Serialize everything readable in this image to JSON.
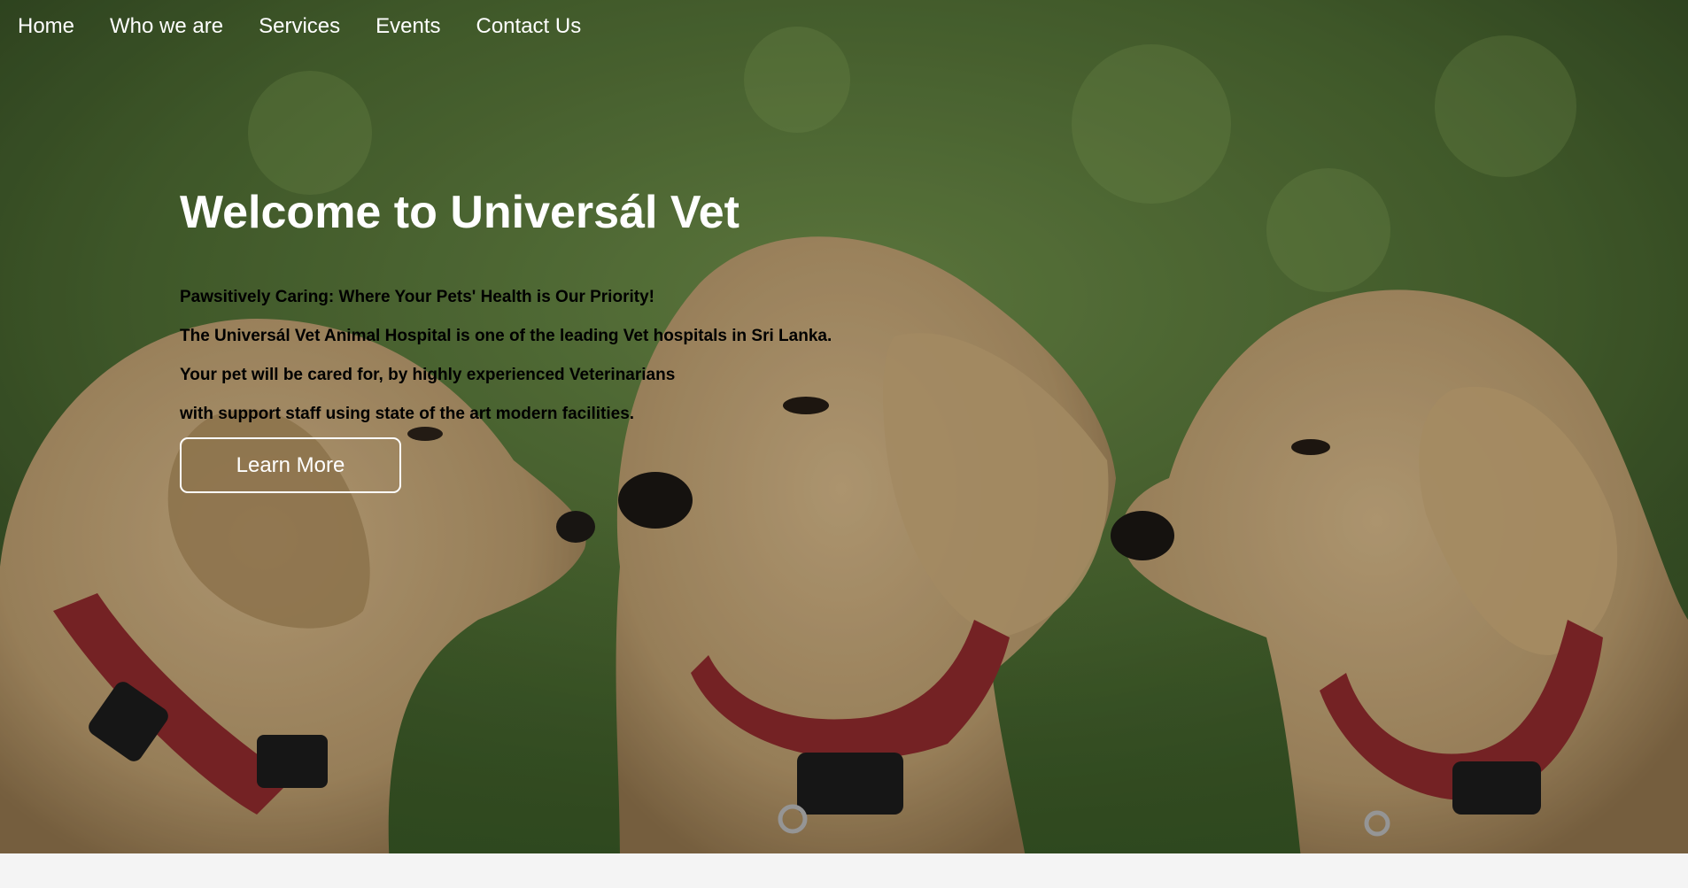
{
  "nav": {
    "items": [
      {
        "label": "Home"
      },
      {
        "label": "Who we are"
      },
      {
        "label": "Services"
      },
      {
        "label": "Events"
      },
      {
        "label": "Contact Us"
      }
    ]
  },
  "hero": {
    "title": "Welcome to Universál Vet",
    "lines": [
      "Pawsitively Caring: Where Your Pets' Health is Our Priority!",
      "The Universál Vet Animal Hospital is one of the leading Vet hospitals in Sri Lanka.",
      "Your pet will be cared for, by highly experienced Veterinarians",
      "with support staff using state of the art modern facilities."
    ],
    "button_label": "Learn More",
    "image": "three-golden-retriever-puppies-red-collars-on-grass"
  },
  "colors": {
    "grass_dark": "#3f5a2c",
    "grass_light": "#6f8f4a",
    "puppy_fur": "#b89a6c",
    "collar_red": "#8e2a2c",
    "footer_bg": "#f4f4f4",
    "title_text": "#ffffff",
    "body_text": "#000000"
  }
}
